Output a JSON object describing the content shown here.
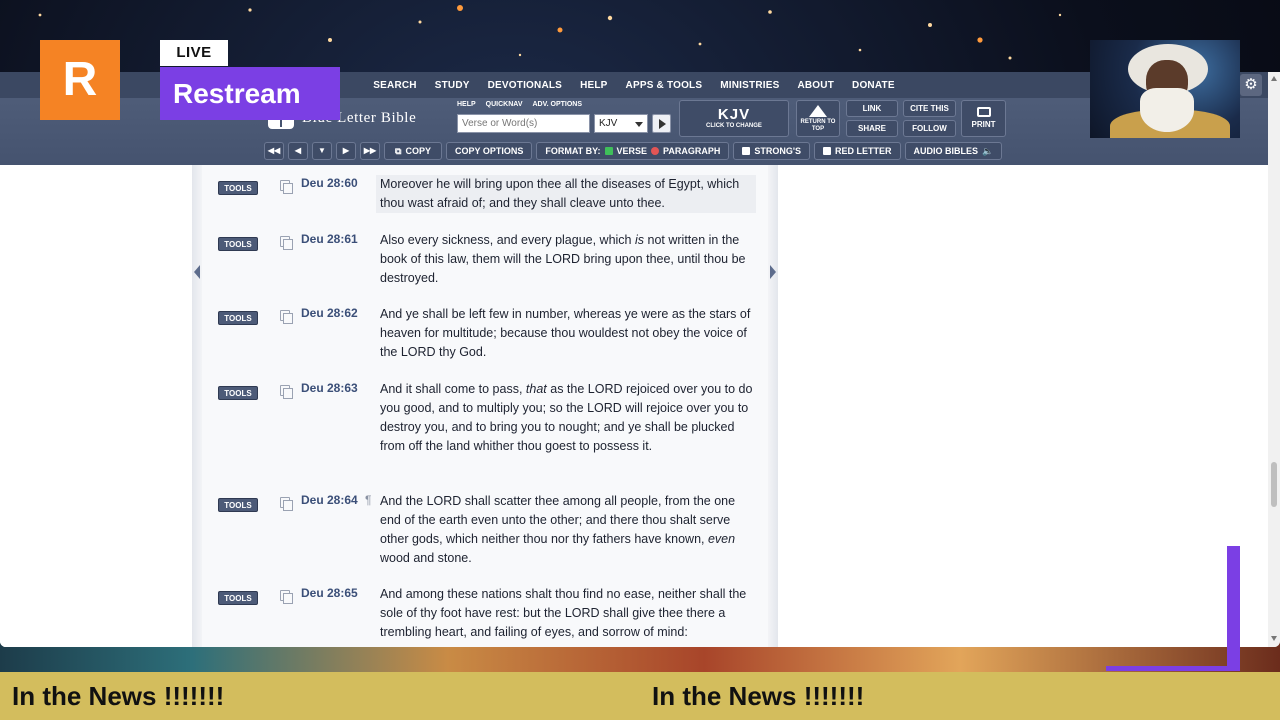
{
  "overlay": {
    "brand_letter": "R",
    "live_label": "LIVE",
    "brand_name": "Restream",
    "ticker": [
      "In the News !!!!!!!",
      "In the News !!!!!!!"
    ],
    "accent_purple": "#7b3fe4",
    "accent_orange": "#f58324"
  },
  "site": {
    "logo_text": "Blue Letter Bible",
    "nav": [
      "SEARCH",
      "STUDY",
      "DEVOTIONALS",
      "HELP",
      "APPS & TOOLS",
      "MINISTRIES",
      "ABOUT",
      "DONATE"
    ],
    "search_links": [
      "HELP",
      "QUICKNAV",
      "ADV. OPTIONS"
    ],
    "search_placeholder": "Verse or Word(s)",
    "version": "KJV",
    "version_box": {
      "name": "KJV",
      "sub": "CLICK TO CHANGE"
    },
    "return_top": "RETURN TO TOP",
    "link": "LINK",
    "share": "SHARE",
    "cite": "CITE THIS",
    "follow": "FOLLOW",
    "print": "PRINT",
    "toolbar": {
      "copy": "COPY",
      "copy_options": "COPY OPTIONS",
      "format_by": "FORMAT BY:",
      "verse": "VERSE",
      "paragraph": "PARAGRAPH",
      "strongs": "STRONG'S",
      "red_letter": "RED LETTER",
      "audio": "AUDIO BIBLES"
    }
  },
  "verses": [
    {
      "tools": "TOOLS",
      "ref": "Deu 28:60",
      "pilcrow": "",
      "text": "Moreover he will bring upon thee all the diseases of Egypt, which thou wast afraid of; and they shall cleave unto thee."
    },
    {
      "tools": "TOOLS",
      "ref": "Deu 28:61",
      "pilcrow": "",
      "text_parts": [
        "Also every sickness, and every plague, which ",
        "is",
        " not written in the book of this law, them will the LORD bring upon thee, until thou be destroyed."
      ]
    },
    {
      "tools": "TOOLS",
      "ref": "Deu 28:62",
      "pilcrow": "",
      "text": "And ye shall be left few in number, whereas ye were as the stars of heaven for multitude; because thou wouldest not obey the voice of the LORD thy God."
    },
    {
      "tools": "TOOLS",
      "ref": "Deu 28:63",
      "pilcrow": "",
      "text_parts": [
        "And it shall come to pass, ",
        "that",
        " as the LORD rejoiced over you to do you good, and to multiply you; so the LORD will rejoice over you to destroy you, and to bring you to nought; and ye shall be plucked from off the land whither thou goest to possess it."
      ]
    },
    {
      "tools": "TOOLS",
      "ref": "Deu 28:64",
      "pilcrow": "¶",
      "text_parts": [
        "And the LORD shall scatter thee among all people, from the one end of the earth even unto the other; and there thou shalt serve other gods, which neither thou nor thy fathers have known, ",
        "even",
        " wood and stone."
      ]
    },
    {
      "tools": "TOOLS",
      "ref": "Deu 28:65",
      "pilcrow": "",
      "text": "And among these nations shalt thou find no ease, neither shall the sole of thy foot have rest: but the LORD shall give thee there a trembling heart, and failing of eyes, and sorrow of mind:"
    }
  ]
}
